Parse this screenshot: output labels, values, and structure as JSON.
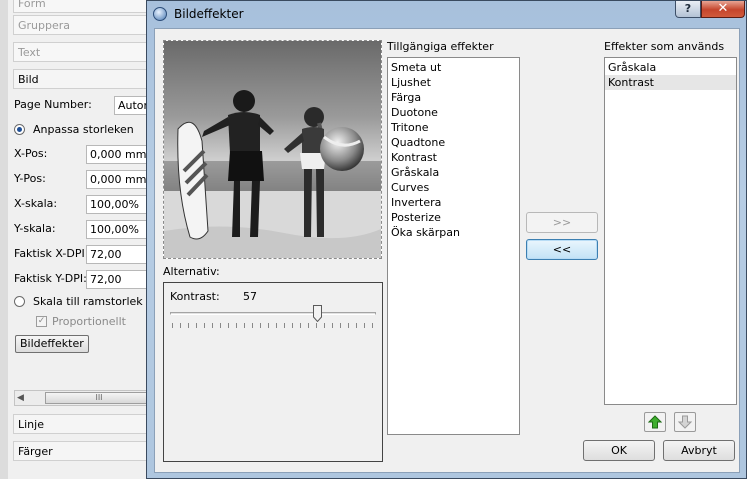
{
  "bg_panel": {
    "sections": {
      "form": "Form",
      "group": "Gruppera",
      "text": "Text",
      "image": "Bild",
      "line": "Linje",
      "colors": "Färger"
    },
    "page_number_label": "Page Number:",
    "page_number_value": "Autom",
    "radio_fit": "Anpassa storleken",
    "fields": [
      {
        "label": "X-Pos:",
        "value": "0,000 mm"
      },
      {
        "label": "Y-Pos:",
        "value": "0,000 mm"
      },
      {
        "label": "X-skala:",
        "value": "100,00%"
      },
      {
        "label": "Y-skala:",
        "value": "100,00%"
      },
      {
        "label": "Faktisk X-DPI:",
        "value": "72,00"
      },
      {
        "label": "Faktisk Y-DPI:",
        "value": "72,00"
      }
    ],
    "radio_scale": "Skala till ramstorlek",
    "checkbox_proportional": "Proportionellt",
    "image_effects_button": "Bildeffekter",
    "scroll_thumb_glyph": "III"
  },
  "dialog": {
    "title": "Bildeffekter",
    "help_glyph": "?",
    "close_glyph": "✕",
    "available_label": "Tillgängiga effekter",
    "available_effects": [
      "Smeta ut",
      "Ljushet",
      "Färga",
      "Duotone",
      "Tritone",
      "Quadtone",
      "Kontrast",
      "Gråskala",
      "Curves",
      "Invertera",
      "Posterize",
      "Öka skärpan"
    ],
    "used_label": "Effekter som används",
    "used_effects": [
      "Gråskala",
      "Kontrast"
    ],
    "selected_used_index": 1,
    "add_button": ">>",
    "remove_button": "<<",
    "options_label": "Alternativ:",
    "contrast_label": "Kontrast:",
    "contrast_value": "57",
    "ok_button": "OK",
    "cancel_button": "Avbryt",
    "move_up_icon": "arrow-up-icon",
    "move_down_icon": "arrow-down-icon"
  }
}
